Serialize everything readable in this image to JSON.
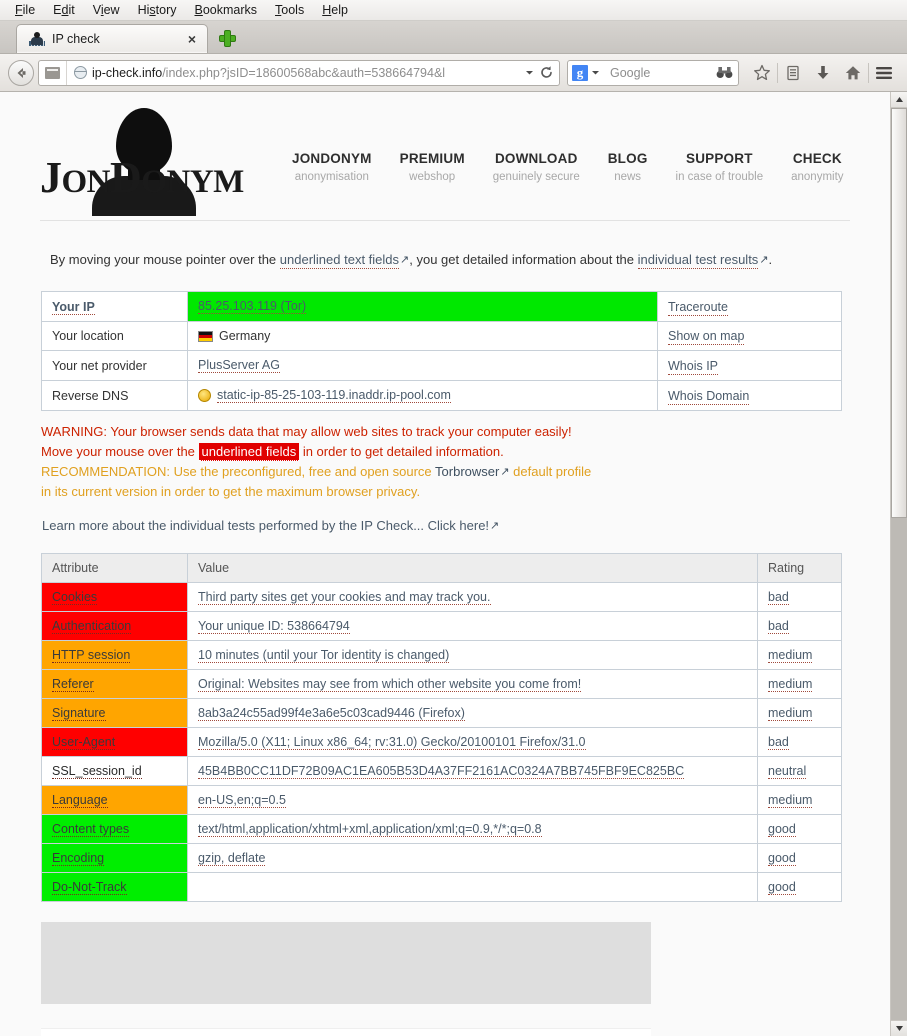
{
  "browser": {
    "menus": [
      "File",
      "Edit",
      "View",
      "History",
      "Bookmarks",
      "Tools",
      "Help"
    ],
    "tab": {
      "title": "IP check",
      "close_label": "×",
      "favicon": "jondonym-favicon"
    },
    "newtab_label": "new-tab",
    "url": {
      "domain": "ip-check.info",
      "path": "/index.php?jsID=18600568abc&auth=538664794&l"
    },
    "search": {
      "engine": "Google",
      "label": "Google"
    },
    "toolbar_icons": [
      "bookmark-star-icon",
      "reader-list-icon",
      "download-arrow-icon",
      "home-icon",
      "menu-hamburger-icon"
    ]
  },
  "site": {
    "logo_word_a": "J",
    "logo_word_b": "ON",
    "logo_word_c": "D",
    "logo_word_d": "ONYM",
    "nav": [
      {
        "main": "JONDONYM",
        "sub": "anonymisation"
      },
      {
        "main": "PREMIUM",
        "sub": "webshop"
      },
      {
        "main": "DOWNLOAD",
        "sub": "genuinely secure"
      },
      {
        "main": "BLOG",
        "sub": "news"
      },
      {
        "main": "SUPPORT",
        "sub": "in case of trouble"
      },
      {
        "main": "CHECK",
        "sub": "anonymity"
      }
    ]
  },
  "intro": {
    "part1": "By moving your mouse pointer over the ",
    "link1": "underlined text fields",
    "part2": ", you get detailed information about the ",
    "link2": "individual test results",
    "part3": "."
  },
  "ip_table": {
    "rows": [
      {
        "label": "Your IP",
        "label_strong": true,
        "value": "85.25.103.119 (Tor)",
        "value_green": true,
        "value_link": true,
        "icon": "none",
        "action": "Traceroute"
      },
      {
        "label": "Your location",
        "label_strong": false,
        "value": "Germany",
        "value_green": false,
        "value_link": false,
        "icon": "flag-de",
        "action": "Show on map"
      },
      {
        "label": "Your net provider",
        "label_strong": false,
        "value": "PlusServer AG",
        "value_green": false,
        "value_link": true,
        "icon": "none",
        "action": "Whois IP"
      },
      {
        "label": "Reverse DNS",
        "label_strong": false,
        "value": "static-ip-85-25-103-119.inaddr.ip-pool.com",
        "value_green": false,
        "value_link": true,
        "icon": "dns-globe",
        "action": "Whois Domain"
      }
    ]
  },
  "warnings": {
    "line1": "WARNING: Your browser sends data that may allow web sites to track your computer easily!",
    "line2_a": "Move your mouse over the ",
    "line2_hl": "underlined fields",
    "line2_b": " in order to get detailed information.",
    "rec_a": "RECOMMENDATION: Use the preconfigured, free and open source ",
    "rec_link": "Torbrowser",
    "rec_b": " default profile",
    "rec_c": "in its current version in order to get the maximum browser privacy.",
    "learn": "Learn more about the individual tests performed by the IP Check... Click here!"
  },
  "attr_table": {
    "headers": [
      "Attribute",
      "Value",
      "Rating"
    ],
    "rows": [
      {
        "attribute": "Cookies",
        "value": "Third party sites get your cookies and may track you.",
        "rating": "bad",
        "level": "bad"
      },
      {
        "attribute": "Authentication",
        "value": "Your unique ID: 538664794",
        "rating": "bad",
        "level": "bad"
      },
      {
        "attribute": "HTTP session",
        "value": "10 minutes (until your Tor identity is changed)",
        "rating": "medium",
        "level": "medium"
      },
      {
        "attribute": "Referer",
        "value": "Original: Websites may see from which other website you come from!",
        "rating": "medium",
        "level": "medium"
      },
      {
        "attribute": "Signature",
        "value": "8ab3a24c55ad99f4e3a6e5c03cad9446 (Firefox)",
        "rating": "medium",
        "level": "medium"
      },
      {
        "attribute": "User-Agent",
        "value": "Mozilla/5.0 (X11; Linux x86_64; rv:31.0) Gecko/20100101 Firefox/31.0",
        "rating": "bad",
        "level": "bad"
      },
      {
        "attribute": "SSL_session_id",
        "value": "45B4BB0CC11DF72B09AC1EA605B53D4A37FF2161AC0324A7BB745FBF9EC825BC",
        "rating": "neutral",
        "level": "neutral"
      },
      {
        "attribute": "Language",
        "value": "en-US,en;q=0.5",
        "rating": "medium",
        "level": "medium"
      },
      {
        "attribute": "Content types",
        "value": "text/html,application/xhtml+xml,application/xml;q=0.9,*/*;q=0.8",
        "rating": "good",
        "level": "good"
      },
      {
        "attribute": "Encoding",
        "value": "gzip, deflate",
        "rating": "good",
        "level": "good"
      },
      {
        "attribute": "Do-Not-Track",
        "value": "",
        "rating": "good",
        "level": "good"
      }
    ]
  },
  "colors": {
    "bad": "#ff0000",
    "medium": "#ffa500",
    "good": "#00ee00",
    "neutral": "#ffffff",
    "ip_highlight": "#00e800",
    "link": "#4a5a6a",
    "warning": "#cc2200",
    "recommendation": "#e0a020"
  }
}
